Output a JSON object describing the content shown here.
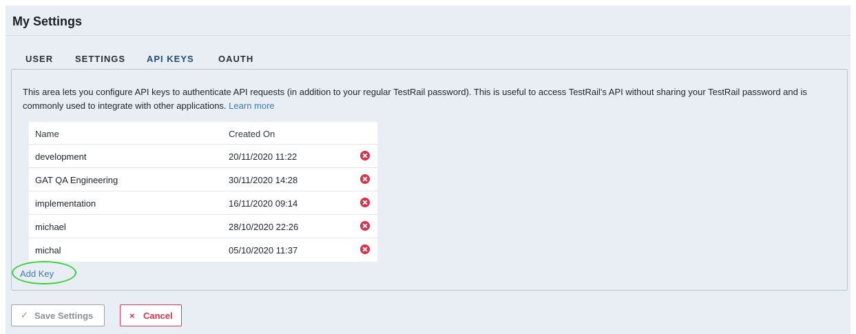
{
  "page": {
    "title": "My Settings"
  },
  "tabs": [
    {
      "label": "USER",
      "active": false
    },
    {
      "label": "SETTINGS",
      "active": false
    },
    {
      "label": "API KEYS",
      "active": true
    },
    {
      "label": "OAUTH",
      "active": false
    }
  ],
  "api_keys": {
    "description": "This area lets you configure API keys to authenticate API requests (in addition to your regular TestRail password). This is useful to access TestRail's API without sharing your TestRail password and is commonly used to integrate with other applications.",
    "learn_more": "Learn more",
    "columns": {
      "name": "Name",
      "created_on": "Created On"
    },
    "rows": [
      {
        "name": "development",
        "created_on": "20/11/2020 11:22"
      },
      {
        "name": "GAT QA Engineering",
        "created_on": "30/11/2020 14:28"
      },
      {
        "name": "implementation",
        "created_on": "16/11/2020 09:14"
      },
      {
        "name": "michael",
        "created_on": "28/10/2020 22:26"
      },
      {
        "name": "michal",
        "created_on": "05/10/2020 11:37"
      }
    ],
    "add_key": "Add Key",
    "delete_icon": "delete-circle-icon"
  },
  "actions": {
    "save": {
      "label": "Save Settings",
      "icon": "checkmark-icon",
      "glyph": "✓"
    },
    "cancel": {
      "label": "Cancel",
      "icon": "x-icon",
      "glyph": "×"
    }
  },
  "colors": {
    "background": "#e8eef4",
    "accent": "#1f4d73",
    "link": "#3a7ab8",
    "danger": "#d9304b",
    "highlight": "#38d23c"
  }
}
